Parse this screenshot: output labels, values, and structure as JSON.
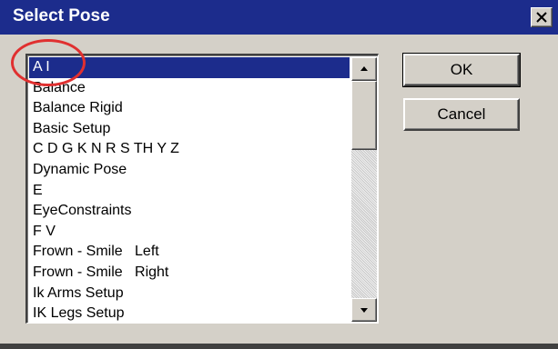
{
  "window": {
    "title": "Select Pose",
    "close_glyph": "✕"
  },
  "pose_list": {
    "items": [
      "A I",
      "Balance",
      "Balance Rigid",
      "Basic Setup",
      "C D G K N R S TH Y Z",
      "Dynamic Pose",
      "E",
      "EyeConstraints",
      "F V",
      "Frown - Smile   Left",
      "Frown - Smile   Right",
      "Ik Arms Setup",
      "IK Legs Setup"
    ],
    "selected": "A I"
  },
  "buttons": {
    "ok_label": "OK",
    "cancel_label": "Cancel"
  },
  "annotation": {
    "color": "#e03030",
    "shape": "circle around selected item"
  },
  "colors": {
    "titlebar": "#1c2c8c",
    "selection": "#1c2c8c",
    "dialog_face": "#d4d0c8"
  }
}
